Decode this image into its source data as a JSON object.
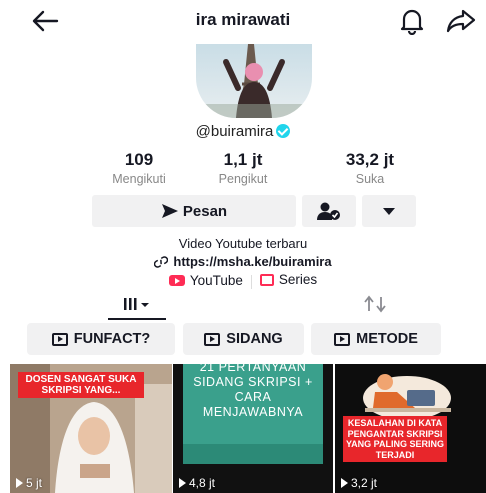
{
  "header": {
    "title": "ira mirawati",
    "icons": [
      "back-arrow-icon",
      "bell-icon",
      "share-icon"
    ]
  },
  "profile": {
    "handle": "@buiramira",
    "verified": true,
    "stats": [
      {
        "value": "109",
        "label": "Mengikuti"
      },
      {
        "value": "1,1 jt",
        "label": "Pengikut"
      },
      {
        "value": "33,2 jt",
        "label": "Suka"
      }
    ],
    "message_label": "Pesan",
    "bio": "Video Youtube terbaru",
    "link": "https://msha.ke/buiramira",
    "youtube_label": "YouTube",
    "series_label": "Series"
  },
  "playlists": [
    {
      "label": "FUNFACT?"
    },
    {
      "label": "SIDANG"
    },
    {
      "label": "METODE"
    }
  ],
  "videos": [
    {
      "caption": "DOSEN SANGAT SUKA SKRIPSI YANG...",
      "views": "5 jt"
    },
    {
      "caption": "21 PERTANYAAN SIDANG SKRIPSI + CARA MENJAWABNYA",
      "views": "4,8 jt"
    },
    {
      "caption": "KESALAHAN DI KATA PENGANTAR SKRIPSI YANG PALING SERING TERJADI",
      "views": "3,2 jt"
    }
  ],
  "colors": {
    "accent": "#fe2c55",
    "verified": "#20d5ec",
    "button_bg": "#f1f1f2",
    "thumb2_bg": "#3aa08c"
  }
}
